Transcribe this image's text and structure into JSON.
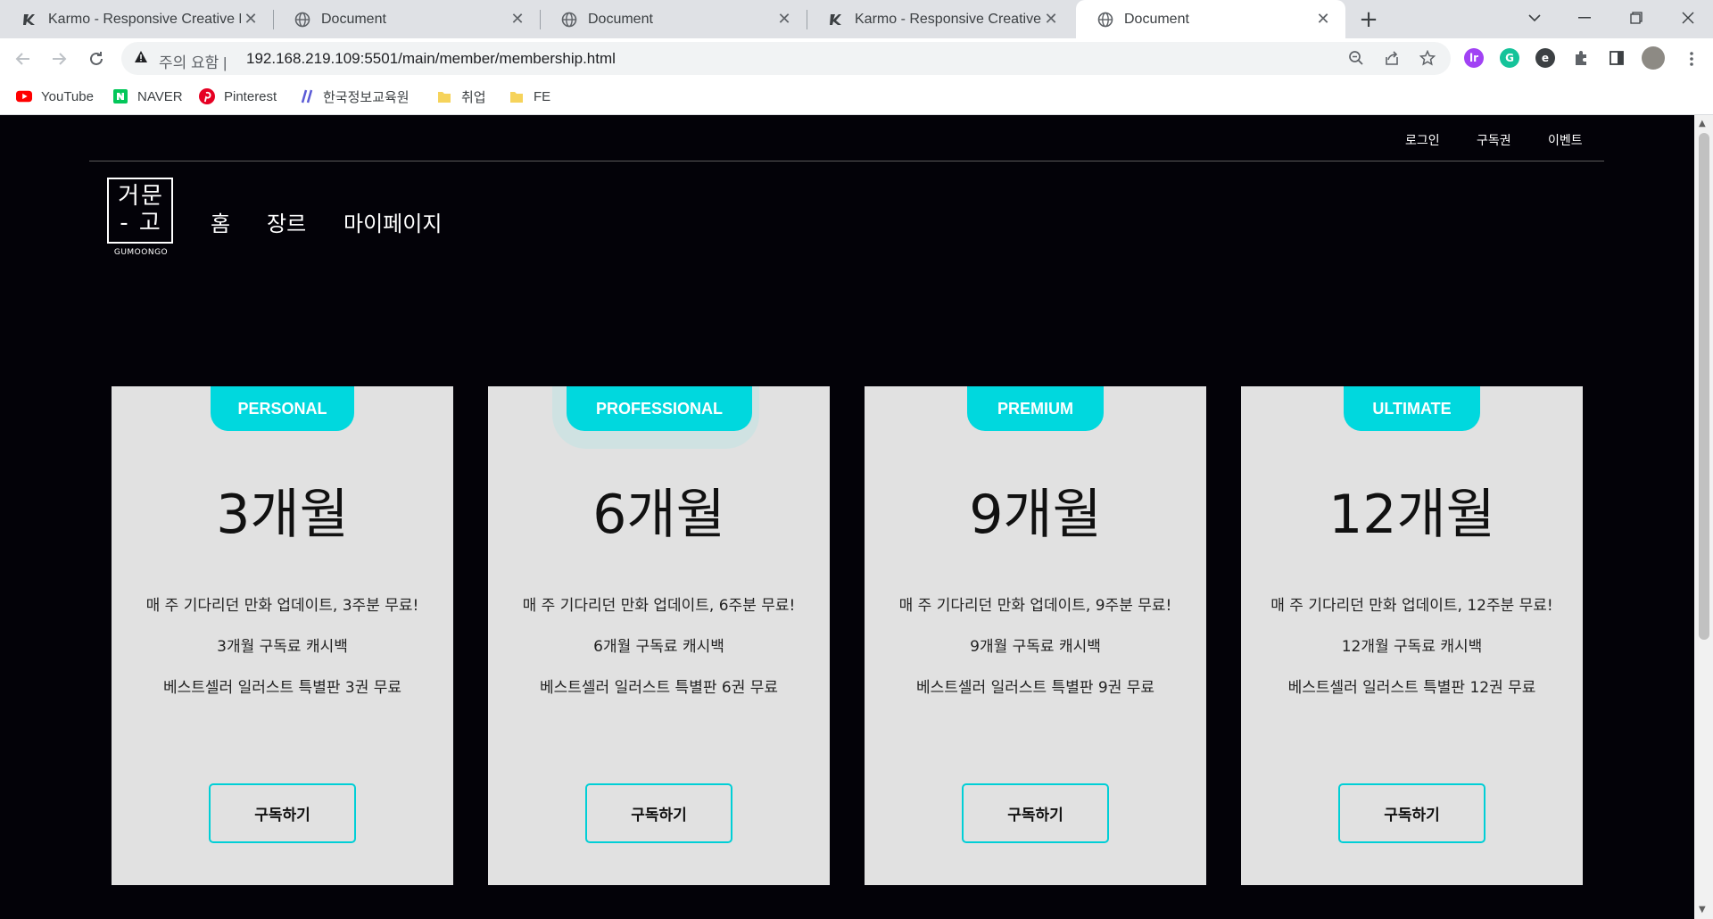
{
  "browser": {
    "tabs": [
      {
        "title": "Karmo - Responsive Creative HT",
        "favicon": "karmo-icon",
        "active": false
      },
      {
        "title": "Document",
        "favicon": "globe-icon",
        "active": false
      },
      {
        "title": "Document",
        "favicon": "globe-icon",
        "active": false
      },
      {
        "title": "Karmo - Responsive Creative HT",
        "favicon": "karmo-icon",
        "active": false
      },
      {
        "title": "Document",
        "favicon": "globe-icon",
        "active": true
      }
    ],
    "address": {
      "security_label": "주의 요함",
      "separator": "|",
      "url": "192.168.219.109:5501/main/member/membership.html"
    },
    "bookmarks": [
      {
        "label": "YouTube",
        "icon": "youtube-icon",
        "color": "#ff0000"
      },
      {
        "label": "NAVER",
        "icon": "naver-icon",
        "color": "#03c75a"
      },
      {
        "label": "Pinterest",
        "icon": "pinterest-icon",
        "color": "#e60023"
      },
      {
        "label": "한국정보교육원",
        "icon": "slash-icon",
        "color": "#5b5bd6"
      },
      {
        "label": "취업",
        "icon": "folder-icon",
        "color": "#f6d35b"
      },
      {
        "label": "FE",
        "icon": "folder-icon",
        "color": "#f6d35b"
      }
    ]
  },
  "site": {
    "top_links": [
      "로그인",
      "구독권",
      "이벤트"
    ],
    "logo": {
      "line1": "거문",
      "line2": "- 고",
      "sub": "GUMOONGO"
    },
    "main_nav": [
      "홈",
      "장르",
      "마이페이지"
    ],
    "accent_color": "#00d8de",
    "background_color": "#030208",
    "plans": [
      {
        "badge": "PERSONAL",
        "period": "3개월",
        "features": [
          "매 주 기다리던 만화 업데이트, 3주분 무료!",
          "3개월 구독료 캐시백",
          "베스트셀러 일러스트 특별판 3권 무료"
        ],
        "button": "구독하기"
      },
      {
        "badge": "PROFESSIONAL",
        "period": "6개월",
        "features": [
          "매 주 기다리던 만화 업데이트, 6주분 무료!",
          "6개월 구독료 캐시백",
          "베스트셀러 일러스트 특별판 6권 무료"
        ],
        "button": "구독하기"
      },
      {
        "badge": "PREMIUM",
        "period": "9개월",
        "features": [
          "매 주 기다리던 만화 업데이트, 9주분 무료!",
          "9개월 구독료 캐시백",
          "베스트셀러 일러스트 특별판 9권 무료"
        ],
        "button": "구독하기"
      },
      {
        "badge": "ULTIMATE",
        "period": "12개월",
        "features": [
          "매 주 기다리던 만화 업데이트, 12주분 무료!",
          "12개월 구독료 캐시백",
          "베스트셀러 일러스트 특별판 12권 무료"
        ],
        "button": "구독하기"
      }
    ]
  }
}
